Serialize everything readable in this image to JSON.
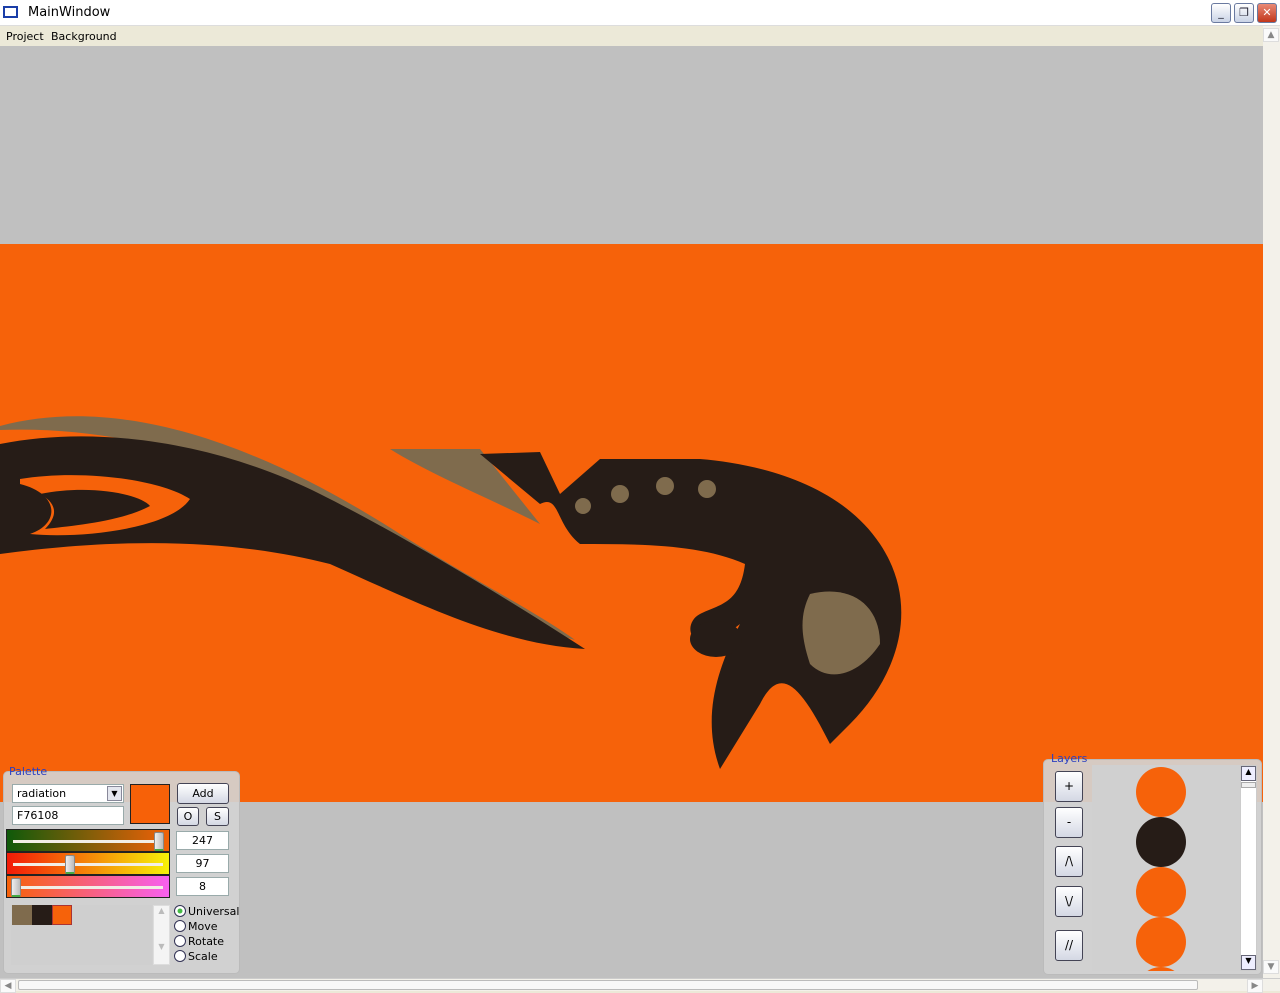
{
  "window": {
    "title": "MainWindow",
    "minimize": "_",
    "restore": "❐",
    "close": "✕"
  },
  "menu": [
    "Project",
    "Background"
  ],
  "palette": {
    "title": "Palette",
    "scheme": "radiation",
    "hex": "F76108",
    "current_color": "#F76108",
    "add_label": "Add",
    "o_label": "O",
    "s_label": "S",
    "sliders": [
      {
        "name": "red",
        "value": "247",
        "fraction": 0.969
      },
      {
        "name": "green",
        "value": "97",
        "fraction": 0.38
      },
      {
        "name": "blue",
        "value": "8",
        "fraction": 0.031
      }
    ],
    "swatches": [
      "#7f6b4d",
      "#261c17",
      "#f6620a"
    ],
    "modes": [
      {
        "label": "Universal",
        "selected": true
      },
      {
        "label": "Move",
        "selected": false
      },
      {
        "label": "Rotate",
        "selected": false
      },
      {
        "label": "Scale",
        "selected": false
      }
    ]
  },
  "layers": {
    "title": "Layers",
    "buttons": [
      "+",
      "-",
      "/\\",
      "\\/",
      "//"
    ],
    "items": [
      "#f6620a",
      "#261c17",
      "#f6620a",
      "#f6620a"
    ]
  },
  "colors": {
    "background": "#c0c0c0",
    "band": "#f6620a",
    "dark": "#261c17",
    "tan": "#7f6b4d"
  }
}
